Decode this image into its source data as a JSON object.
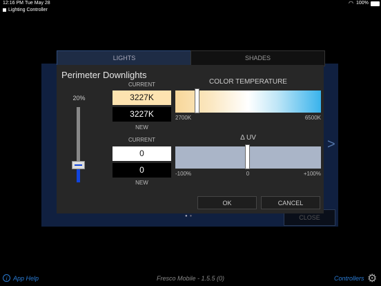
{
  "status_bar": {
    "time": "12:16 PM",
    "date": "Tue May 28",
    "battery": "100%"
  },
  "app_title": "Lighting Controller",
  "tabs": [
    {
      "label": "LIGHTS"
    },
    {
      "label": "SHADES"
    }
  ],
  "dialog": {
    "title": "Perimeter Downlights",
    "level": {
      "label": "20%",
      "value": 0.2
    },
    "color_temperature": {
      "label": "COLOR TEMPERATURE",
      "current_label": "CURRENT",
      "current_value": "3227K",
      "new_value": "3227K",
      "new_label": "NEW",
      "min_label": "2700K",
      "max_label": "6500K"
    },
    "delta_uv": {
      "label": "Δ UV",
      "current_label": "CURRENT",
      "current_value": "0",
      "new_value": "0",
      "new_label": "NEW",
      "min_label": "-100%",
      "mid_label": "0",
      "max_label": "+100%"
    },
    "ok_label": "OK",
    "cancel_label": "CANCEL"
  },
  "background": {
    "close_label": "CLOSE"
  },
  "footer": {
    "help_label": "App Help",
    "version": "Fresco Mobile - 1.5.5 (0)",
    "controllers_label": "Controllers"
  }
}
